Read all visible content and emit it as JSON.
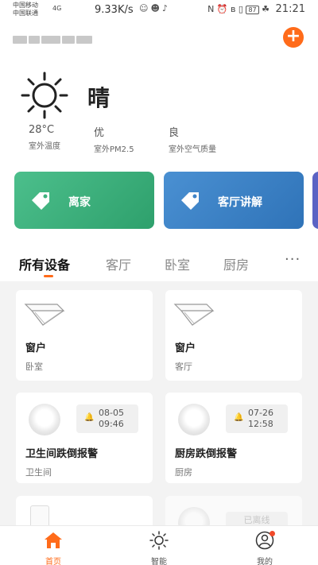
{
  "status_bar": {
    "carrier1": "中国移动",
    "carrier2": "中国联通",
    "network": "4G",
    "speed": "9.33K/s",
    "battery": "87",
    "time": "21:21"
  },
  "header": {
    "add_button": "+"
  },
  "weather": {
    "condition": "晴",
    "stats": [
      {
        "value": "28°C",
        "label": "室外温度"
      },
      {
        "value": "优",
        "label": "室外PM2.5"
      },
      {
        "value": "良",
        "label": "室外空气质量"
      }
    ]
  },
  "scenes": [
    {
      "label": "离家",
      "color": "#3fb27f"
    },
    {
      "label": "客厅讲解",
      "color": "#3f84c8"
    }
  ],
  "tabs": [
    "所有设备",
    "客厅",
    "卧室",
    "厨房"
  ],
  "more_label": "···",
  "devices": [
    {
      "title": "窗户",
      "room": "卧室"
    },
    {
      "title": "窗户",
      "room": "客厅"
    },
    {
      "title": "卫生间跌倒报警",
      "room": "卫生间",
      "alarm_date": "08-05",
      "alarm_time": "09:46"
    },
    {
      "title": "厨房跌倒报警",
      "room": "厨房",
      "alarm_date": "07-26",
      "alarm_time": "12:58"
    },
    {
      "offline": "已离线"
    }
  ],
  "bottom_nav": [
    {
      "label": "首页",
      "icon": "home-icon"
    },
    {
      "label": "智能",
      "icon": "sun-icon"
    },
    {
      "label": "我的",
      "icon": "user-icon"
    }
  ],
  "colors": {
    "accent": "#ff6b1a"
  }
}
